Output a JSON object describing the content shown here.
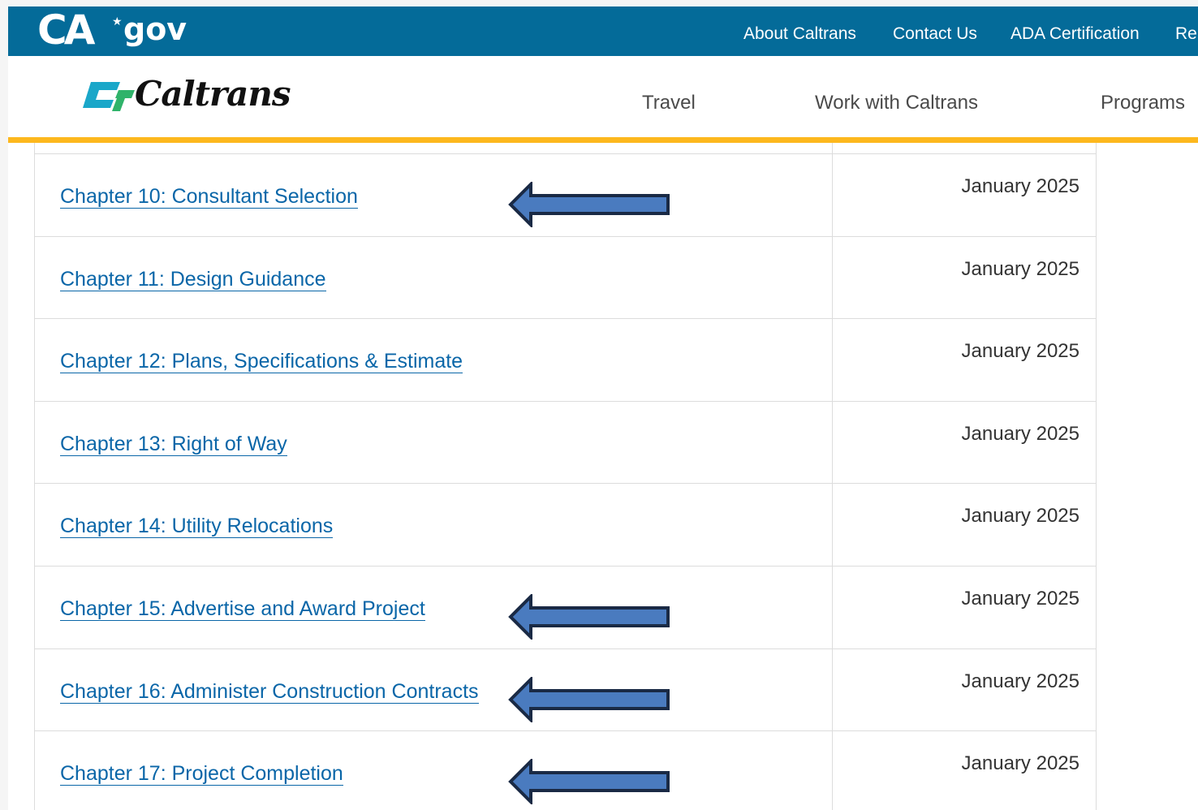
{
  "cagov": {
    "logo_ca": "CA",
    "logo_gov": "gov",
    "nav": [
      "About Caltrans",
      "Contact Us",
      "ADA Certification",
      "Re"
    ]
  },
  "header": {
    "logo_text": "Caltrans",
    "nav": [
      "Travel",
      "Work with Caltrans",
      "Programs"
    ]
  },
  "colors": {
    "cagov_blue": "#046b99",
    "gold": "#fdb81e",
    "link": "#0a66a8",
    "arrow_fill": "#4a7bbf",
    "arrow_stroke": "#1a2a45"
  },
  "rows": [
    {
      "title": "Chapter 10: Consultant Selection",
      "date": "January 2025",
      "arrow": true
    },
    {
      "title": "Chapter 11: Design Guidance",
      "date": "January 2025",
      "arrow": false
    },
    {
      "title": "Chapter 12: Plans, Specifications & Estimate",
      "date": "January 2025",
      "arrow": false
    },
    {
      "title": "Chapter 13: Right of Way",
      "date": "January 2025",
      "arrow": false
    },
    {
      "title": "Chapter 14: Utility Relocations",
      "date": "January 2025",
      "arrow": false
    },
    {
      "title": "Chapter 15: Advertise and Award Project",
      "date": "January 2025",
      "arrow": true
    },
    {
      "title": "Chapter 16: Administer Construction Contracts",
      "date": "January 2025",
      "arrow": true
    },
    {
      "title": "Chapter 17: Project Completion",
      "date": "January 2025",
      "arrow": true
    }
  ]
}
